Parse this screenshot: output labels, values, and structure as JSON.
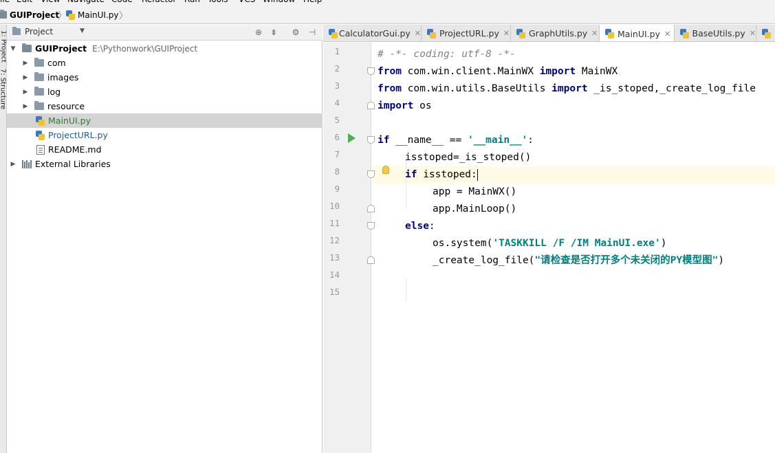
{
  "menu": [
    "ile",
    "Edit",
    "View",
    "Navigate",
    "Code",
    "Refactor",
    "Run",
    "Tools",
    "VCS",
    "Window",
    "Help"
  ],
  "breadcrumb": {
    "project": "GUIProject",
    "file": "MainUI.py"
  },
  "stripe": {
    "project_label": "1: Project",
    "structure_label": "7: Structure"
  },
  "project_panel": {
    "title": "Project",
    "root": {
      "name": "GUIProject",
      "path": "E:\\Pythonwork\\GUIProject"
    },
    "items": [
      {
        "name": "com",
        "type": "folder"
      },
      {
        "name": "images",
        "type": "folder"
      },
      {
        "name": "log",
        "type": "folder"
      },
      {
        "name": "resource",
        "type": "folder"
      },
      {
        "name": "MainUI.py",
        "type": "py",
        "selected": true
      },
      {
        "name": "ProjectURL.py",
        "type": "py"
      },
      {
        "name": "README.md",
        "type": "md"
      }
    ],
    "external": "External Libraries"
  },
  "tabs": [
    {
      "label": "CalculatorGui.py"
    },
    {
      "label": "ProjectURL.py"
    },
    {
      "label": "GraphUtils.py"
    },
    {
      "label": "MainUI.py",
      "active": true
    },
    {
      "label": "BaseUtils.py"
    }
  ],
  "code": {
    "line_numbers": [
      "1",
      "2",
      "3",
      "4",
      "5",
      "6",
      "7",
      "8",
      "9",
      "10",
      "11",
      "12",
      "13",
      "14",
      "15"
    ],
    "l1": "# -*- coding: utf-8 -*-",
    "l2_kw1": "from",
    "l2_mid": " com.win.client.MainWX ",
    "l2_kw2": "import",
    "l2_end": " MainWX",
    "l3_kw1": "from",
    "l3_mid": " com.win.utils.BaseUtils ",
    "l3_kw2": "import",
    "l3_end": " _is_stoped,_create_log_file",
    "l4_kw": "import",
    "l4_end": " os",
    "l6_kw": "if",
    "l6_mid": " __name__ == ",
    "l6_str": "'__main__'",
    "l6_end": ":",
    "l7": "isstoped=_is_stoped()",
    "l8_kw": "if",
    "l8_end": " isstoped:",
    "l9": "app = MainWX()",
    "l10": "app.MainLoop()",
    "l11_kw": "else",
    "l11_end": ":",
    "l12_pre": "os.system(",
    "l12_str": "'TASKKILL /F /IM MainUI.exe'",
    "l12_end": ")",
    "l13_pre": "_create_log_file(",
    "l13_str": "\"请检查是否打开多个未关闭的PY模型图\"",
    "l13_end": ")"
  }
}
